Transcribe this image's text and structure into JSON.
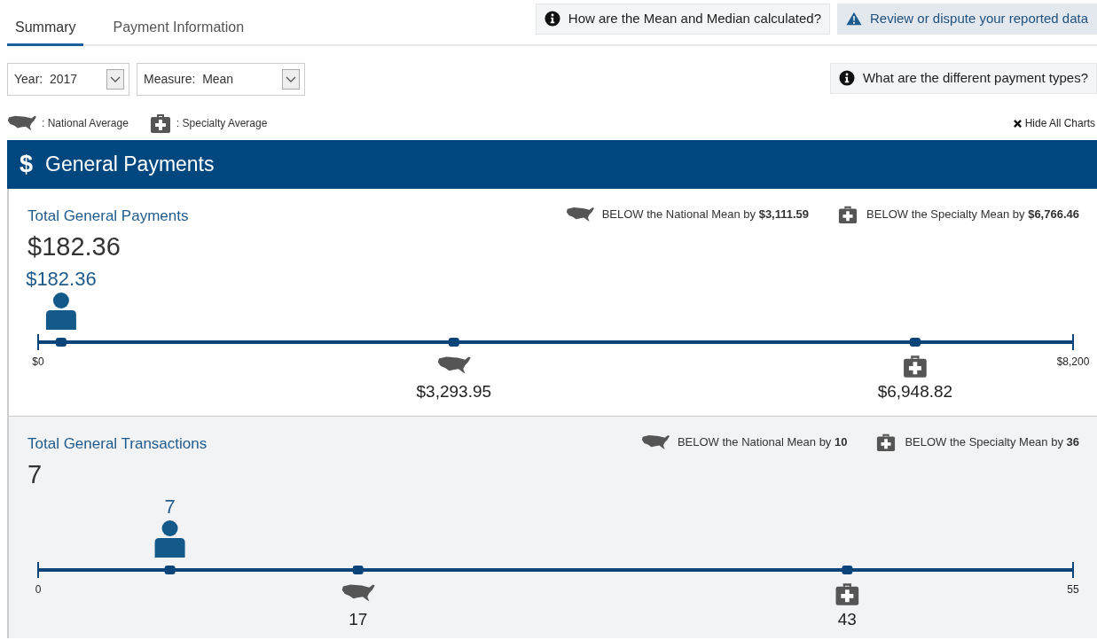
{
  "tabs": [
    {
      "label": "Summary",
      "selected": true
    },
    {
      "label": "Payment Information",
      "selected": false
    }
  ],
  "help_buttons": [
    {
      "kind": "info",
      "label": "How are the Mean and Median calculated?"
    },
    {
      "kind": "warning",
      "label": "Review or dispute your reported data"
    }
  ],
  "filters": [
    {
      "label": "Year:",
      "value": "2017"
    },
    {
      "label": "Measure:",
      "value": "Mean"
    }
  ],
  "payment_types_button": {
    "label": "What are the different payment types?"
  },
  "legend": [
    {
      "kind": "national",
      "label": ": National Average"
    },
    {
      "kind": "specialty",
      "label": ": Specialty Average"
    }
  ],
  "hide_charts_link": "Hide All Charts",
  "section": {
    "icon": "$",
    "title": "General Payments"
  },
  "metrics": [
    {
      "title": "Total General Payments",
      "value": "$182.36",
      "comparisons": [
        {
          "kind": "national",
          "text": "BELOW the National Mean by **$3,111.59**"
        },
        {
          "kind": "specialty",
          "text": "BELOW the Specialty Mean by **$6,766.46**"
        }
      ],
      "scale": {
        "min_label": "$0",
        "max_label": "$8,200"
      },
      "markers": [
        {
          "kind": "person",
          "level": 0.0222,
          "label": "$182.36"
        },
        {
          "kind": "national",
          "level": 0.4017,
          "label": "$3,293.95"
        },
        {
          "kind": "specialty",
          "level": 0.8474,
          "label": "$6,948.82"
        }
      ]
    },
    {
      "title": "Total General Transactions",
      "value": "7",
      "comparisons": [
        {
          "kind": "national",
          "text": "BELOW the National Mean by **10**"
        },
        {
          "kind": "specialty",
          "text": "BELOW the Specialty Mean by **36**"
        }
      ],
      "scale": {
        "min_label": "0",
        "max_label": "55"
      },
      "markers": [
        {
          "kind": "person",
          "level": 0.1273,
          "label": "7"
        },
        {
          "kind": "national",
          "level": 0.3091,
          "label": "17"
        },
        {
          "kind": "specialty",
          "level": 0.7818,
          "label": "43"
        }
      ]
    }
  ]
}
